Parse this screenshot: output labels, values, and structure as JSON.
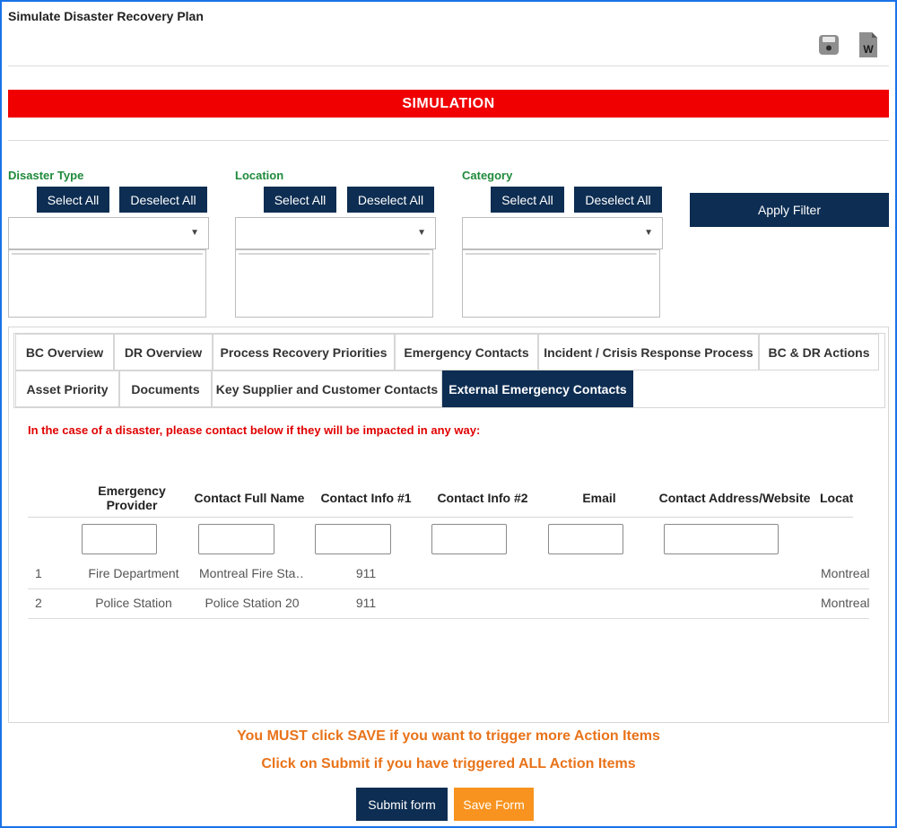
{
  "page": {
    "title": "Simulate Disaster Recovery Plan"
  },
  "icons": {
    "save": "save-disk-icon",
    "word": "word-document-icon"
  },
  "banner": {
    "text": "SIMULATION",
    "color": "#f00000"
  },
  "filters": {
    "disaster_type": {
      "label": "Disaster Type",
      "select_all": "Select All",
      "deselect_all": "Deselect All",
      "selected": ""
    },
    "location": {
      "label": "Location",
      "select_all": "Select All",
      "deselect_all": "Deselect All",
      "selected": ""
    },
    "category": {
      "label": "Category",
      "select_all": "Select All",
      "deselect_all": "Deselect All",
      "selected": ""
    },
    "apply_label": "Apply Filter"
  },
  "tabs": [
    {
      "label": "BC Overview",
      "active": false
    },
    {
      "label": "DR Overview",
      "active": false
    },
    {
      "label": "Process Recovery Priorities",
      "active": false
    },
    {
      "label": "Emergency Contacts",
      "active": false
    },
    {
      "label": "Incident / Crisis Response Process",
      "active": false
    },
    {
      "label": "BC & DR Actions",
      "active": false
    },
    {
      "label": "Asset Priority",
      "active": false
    },
    {
      "label": "Documents",
      "active": false
    },
    {
      "label": "Key Supplier and Customer Contacts",
      "active": false
    },
    {
      "label": "External Emergency Contacts",
      "active": true
    }
  ],
  "content": {
    "warning": "In the case of a disaster, please contact below if they will be impacted in any way:",
    "columns": [
      "Emergency Provider",
      "Contact Full Name",
      "Contact Info #1",
      "Contact Info #2",
      "Email",
      "Contact Address/Website",
      "Locati"
    ],
    "rows": [
      {
        "num": "1",
        "provider": "Fire Department",
        "name": "Montreal Fire Sta…",
        "info1": "911",
        "info2": "",
        "email": "",
        "address": "",
        "location": "Montreal"
      },
      {
        "num": "2",
        "provider": "Police Station",
        "name": "Police Station 20",
        "info1": "911",
        "info2": "",
        "email": "",
        "address": "",
        "location": "Montreal"
      }
    ]
  },
  "notes": {
    "save_note": "You MUST click SAVE if you want to trigger more Action Items",
    "submit_note": "Click on Submit if you have triggered ALL Action Items"
  },
  "actions": {
    "submit": "Submit form",
    "save": "Save Form"
  },
  "colors": {
    "navy": "#0d2d52",
    "green_label": "#1f8a3b",
    "orange": "#e8731a",
    "save_button": "#f7931e"
  }
}
